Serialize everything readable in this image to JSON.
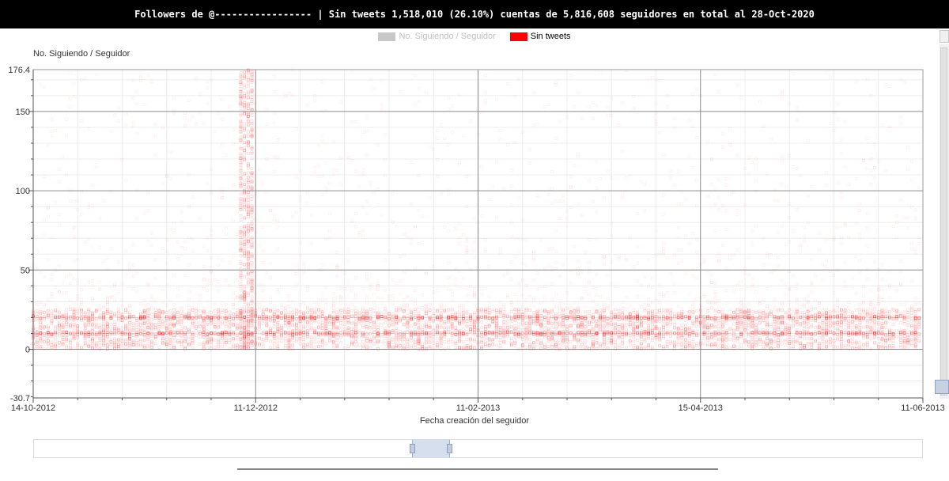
{
  "chart_data": {
    "type": "scatter",
    "title": "Followers de @----------------- | Sin tweets 1,518,010 (26.10%) cuentas de 5,816,608 seguidores en total al 28-Oct-2020",
    "xlabel": "Fecha creación del seguidor",
    "ylabel": "No. Siguiendo / Seguidor",
    "x_ticks": [
      "14-10-2012",
      "11-12-2012",
      "11-02-2013",
      "15-04-2013",
      "11-06-2013"
    ],
    "xlim": [
      "2012-10-14",
      "2013-06-11"
    ],
    "y_ticks": [
      -30.7,
      0,
      50,
      100,
      150,
      176.4
    ],
    "ylim": [
      -30.7,
      176.4
    ],
    "grid": true,
    "legend_position": "top-center",
    "series": [
      {
        "name": "No. Siguiendo / Seguidor",
        "color": "#c8c8c8",
        "visible": false
      },
      {
        "name": "Sin tweets",
        "color": "#ff0000",
        "visible": true,
        "dense_band": [
          0,
          25
        ],
        "highlight_values": [
          10,
          20
        ],
        "spike_date": "2012-12-11",
        "spike_max": 176.4
      }
    ]
  },
  "ui": {
    "icons": [
      "resize-icon",
      "scroll-grip-icon"
    ]
  }
}
